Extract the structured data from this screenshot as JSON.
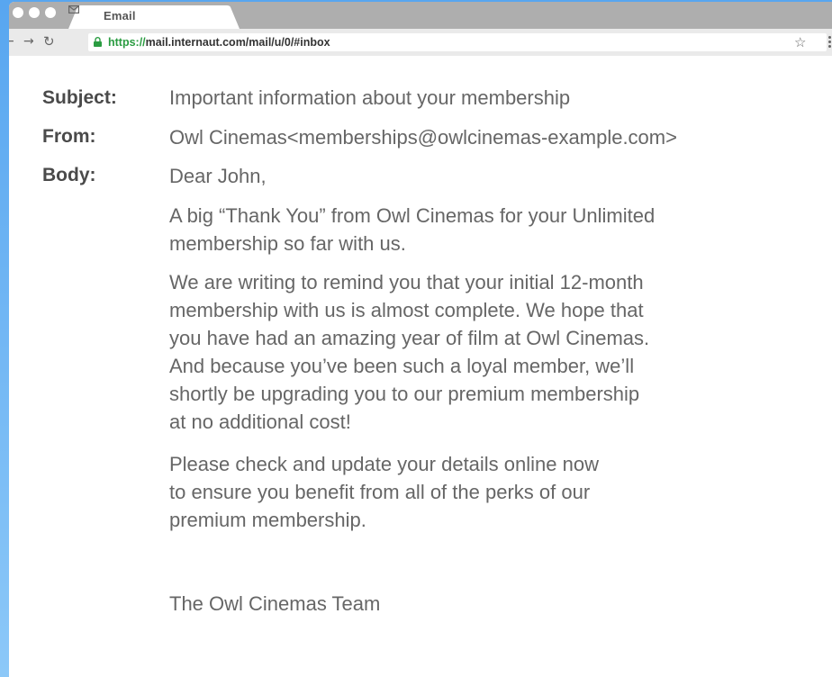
{
  "browser": {
    "tab_title": "Email",
    "url_scheme": "https://",
    "url_rest": "mail.internaut.com/mail/u/0/#inbox",
    "icons": {
      "back": "back-arrow-icon",
      "forward": "forward-arrow-icon",
      "reload": "reload-icon",
      "lock": "lock-icon",
      "bookmark": "star-icon",
      "menu": "menu-dots-icon",
      "tab": "envelope-icon"
    },
    "colors": {
      "secure_green": "#2a9c41",
      "tab_strip": "#aeaeae",
      "desktop_blue": "#58a6f0"
    }
  },
  "email": {
    "subject_label": "Subject:",
    "subject": "Important information about your membership",
    "from_label": "From:",
    "from": "Owl Cinemas<memberships@owlcinemas-example.com>",
    "body_label": "Body:",
    "greeting": "Dear John,",
    "para1": [
      "A big “Thank You” from Owl Cinemas for your Unlimited",
      "membership so far with us."
    ],
    "para2": [
      "We are writing to remind you that your initial 12-month",
      "membership with us is almost complete. We hope that",
      "you have had an amazing year of film at Owl Cinemas.",
      "And because you’ve been such a loyal member, we’ll",
      "shortly be upgrading you to our premium membership",
      "at no additional cost!"
    ],
    "para3": [
      "Please check and update your details online now",
      "to ensure you benefit from all of the perks of our",
      "premium membership."
    ],
    "signature": "The Owl Cinemas Team"
  }
}
